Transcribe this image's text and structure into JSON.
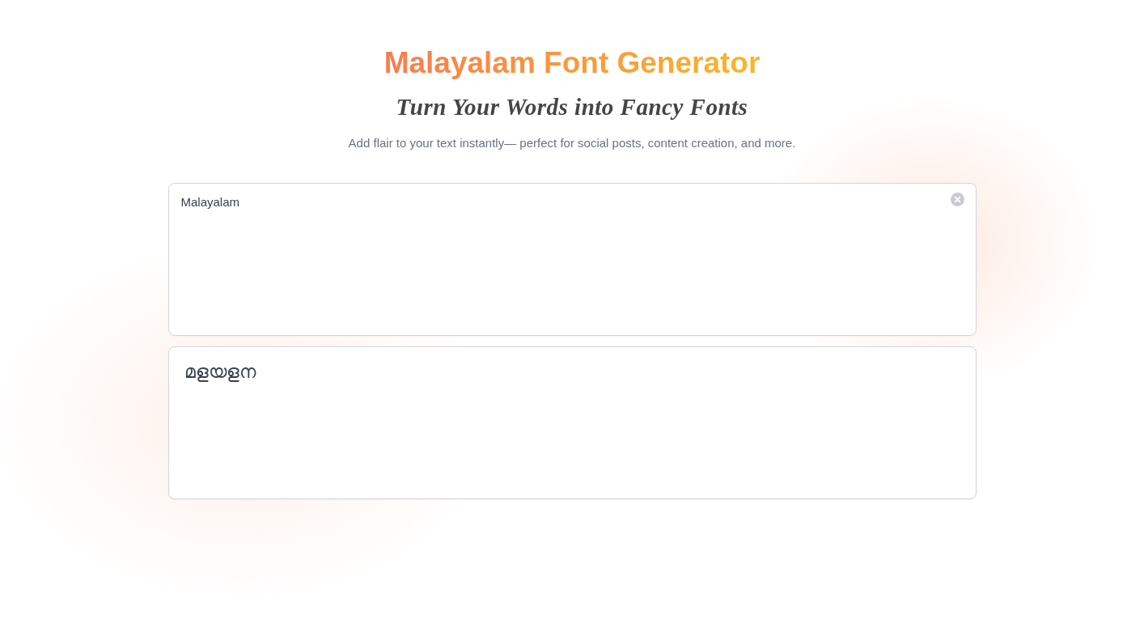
{
  "header": {
    "title": "Malayalam Font Generator",
    "subtitle": "Turn Your Words into Fancy Fonts",
    "description": "Add flair to your text instantly— perfect for social posts, content creation, and more."
  },
  "input": {
    "value": "Malayalam"
  },
  "output": {
    "value": "മളയളന"
  }
}
